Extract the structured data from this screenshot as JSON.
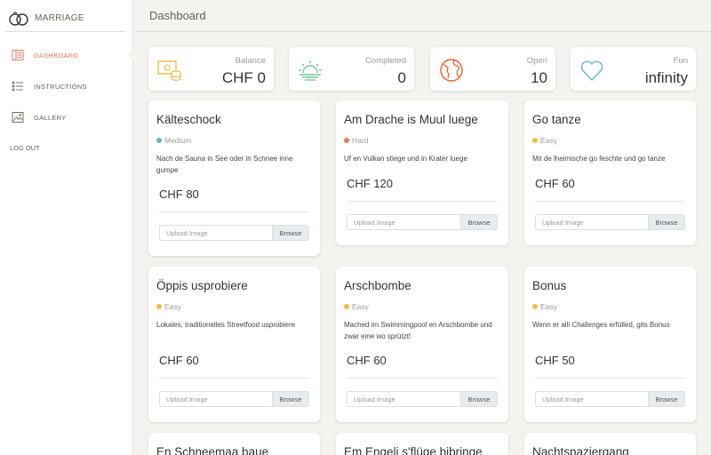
{
  "app": {
    "brand": "MARRIAGE"
  },
  "sidebar": {
    "items": [
      {
        "label": "DASHBOARD",
        "icon": "dashboard-icon",
        "active": true
      },
      {
        "label": "INSTRUCTIONS",
        "icon": "list-icon",
        "active": false
      },
      {
        "label": "GALLERY",
        "icon": "image-icon",
        "active": false
      }
    ],
    "logout": "LOG OUT"
  },
  "header": {
    "title": "Dashboard"
  },
  "stats": [
    {
      "label": "Balance",
      "value": "CHF 0",
      "icon": "money-icon",
      "color": "#f3bb45"
    },
    {
      "label": "Completed",
      "value": "0",
      "icon": "sunrise-icon",
      "color": "#7ac29a"
    },
    {
      "label": "Open",
      "value": "10",
      "icon": "globe-icon",
      "color": "#eb5e28"
    },
    {
      "label": "Fun",
      "value": "infinity",
      "icon": "heart-icon",
      "color": "#68b3c8"
    }
  ],
  "difficulty_colors": {
    "Easy": "#f3bb45",
    "Medium": "#68b3c8",
    "Hard": "#e57a5c"
  },
  "upload": {
    "placeholder": "Upload Image",
    "browse": "Browse"
  },
  "challenges": [
    {
      "title": "Kälteschock",
      "difficulty": "Medium",
      "description": "Nach de Sauna in See oder in Schnee inne gumpe",
      "price": "CHF 80"
    },
    {
      "title": "Am Drache is Muul luege",
      "difficulty": "Hard",
      "description": "Uf en Vulkan stiege und in Krater luege",
      "price": "CHF 120"
    },
    {
      "title": "Go tanze",
      "difficulty": "Easy",
      "description": "Mit de lheimische go feschte und go tanze",
      "price": "CHF 60"
    },
    {
      "title": "Öppis usprobiere",
      "difficulty": "Easy",
      "description": "Lokales, traditionelles Streetfood usprobiere",
      "price": "CHF 60"
    },
    {
      "title": "Arschbombe",
      "difficulty": "Easy",
      "description": "Mached im Swimmingpool en Arschbombe und zwar eine wo sprützt!",
      "price": "CHF 60"
    },
    {
      "title": "Bonus",
      "difficulty": "Easy",
      "description": "Wenn er alli Challenges erfülled, gits Bonus",
      "price": "CHF 50"
    },
    {
      "title": "En Schneemaa baue"
    },
    {
      "title": "Em Engeli s'flüge bibringe"
    },
    {
      "title": "Nachtspaziergang"
    }
  ]
}
